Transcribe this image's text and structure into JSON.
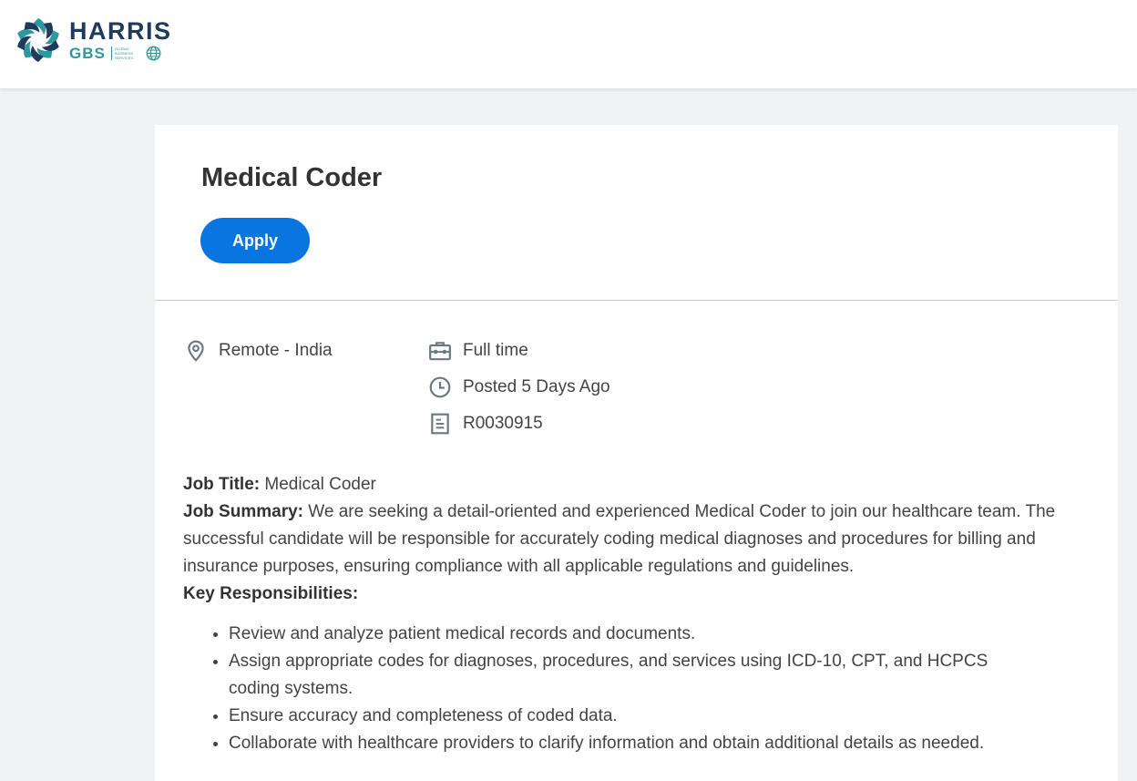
{
  "header": {
    "logo_primary": "HARRIS",
    "logo_secondary": "GBS",
    "logo_small_lines": [
      "GLOBAL",
      "BUSINESS",
      "SERVICES"
    ],
    "brand_colors": {
      "navy": "#1f3a5f",
      "teal": "#2a9a9e"
    }
  },
  "job": {
    "title": "Medical Coder",
    "apply_label": "Apply",
    "accent_color": "#0875e1",
    "location": "Remote - India",
    "time_type": "Full time",
    "posted": "Posted 5 Days Ago",
    "requisition_id": "R0030915",
    "icons": [
      "location-pin-icon",
      "briefcase-icon",
      "clock-icon",
      "document-icon"
    ]
  },
  "description": {
    "job_title_label": "Job Title:",
    "job_title_value": " Medical Coder",
    "summary_label": "Job Summary:",
    "summary_text": " We are seeking a detail-oriented and experienced Medical Coder to join our healthcare team. The successful candidate will be responsible for accurately coding medical diagnoses and procedures for billing and insurance purposes, ensuring compliance with all applicable regulations and guidelines.",
    "responsibilities_label": "Key Responsibilities:",
    "responsibilities": [
      "Review and analyze patient medical records and documents.",
      "Assign appropriate codes for diagnoses, procedures, and services using ICD-10, CPT, and HCPCS coding systems.",
      "Ensure accuracy and completeness of coded data.",
      "Collaborate with healthcare providers to clarify information and obtain additional details as needed."
    ]
  }
}
